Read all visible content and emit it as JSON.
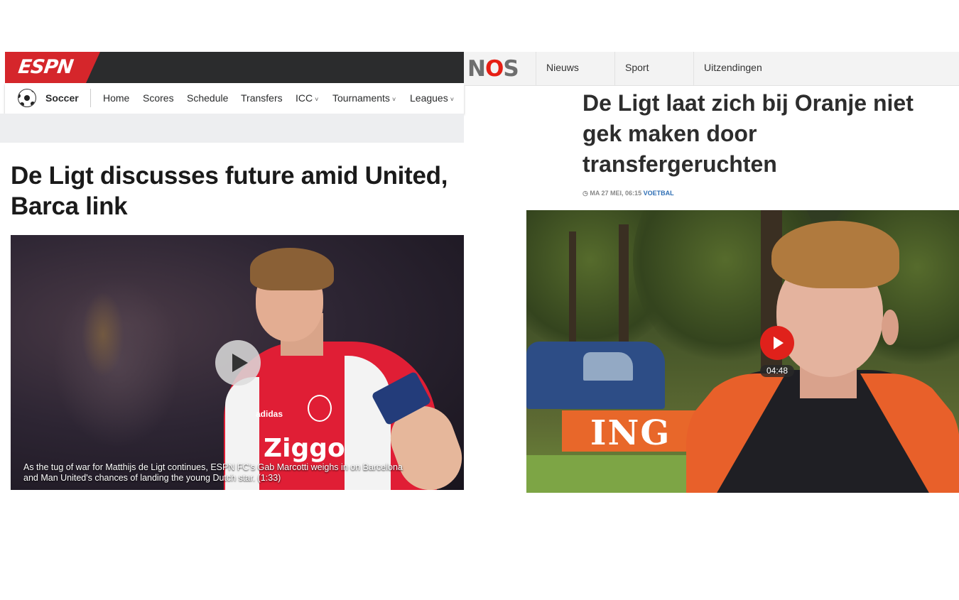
{
  "espn": {
    "logo": "ESPN",
    "subnav": {
      "section": "Soccer",
      "items": [
        {
          "label": "Home",
          "dropdown": false
        },
        {
          "label": "Scores",
          "dropdown": false
        },
        {
          "label": "Schedule",
          "dropdown": false
        },
        {
          "label": "Transfers",
          "dropdown": false
        },
        {
          "label": "ICC",
          "dropdown": true
        },
        {
          "label": "Tournaments",
          "dropdown": true
        },
        {
          "label": "Leagues",
          "dropdown": true
        }
      ]
    },
    "headline": "De Ligt discusses future amid United, Barca link",
    "video": {
      "caption": "As the tug of war for Matthijs de Ligt continues, ESPN FC's Gab Marcotti weighs in on Barcelona and Man United's chances of landing the young Dutch star. (1:33)",
      "jersey_sponsor": "Ziggo",
      "jersey_brand": "adidas"
    },
    "colors": {
      "brand": "#d5262b",
      "topbar": "#2b2c2d"
    }
  },
  "nos": {
    "logo": {
      "n": "N",
      "o": "O",
      "s": "S"
    },
    "nav": [
      "Nieuws",
      "Sport",
      "Uitzendingen"
    ],
    "headline": "De Ligt laat zich bij Oranje niet gek maken door transfergeruchten",
    "meta": {
      "icon": "clock-icon",
      "date": "MA 27 MEI, 06:15",
      "category": "VOETBAL"
    },
    "video": {
      "duration": "04:48",
      "banner_text": "ING"
    },
    "colors": {
      "brand": "#e61e14",
      "category": "#2e6eb4"
    }
  },
  "chevron": "˅"
}
